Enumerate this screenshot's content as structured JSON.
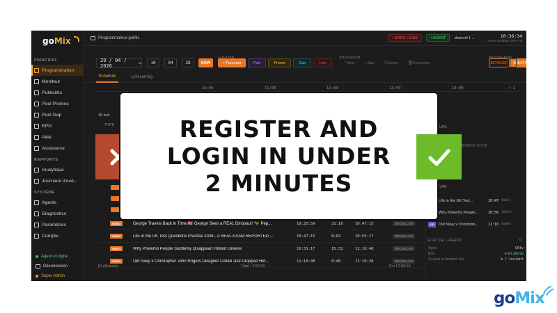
{
  "app": {
    "logo": {
      "go": "go",
      "mix": "Mix"
    },
    "window_title": "Programmateur goMix",
    "status_live": "• HORS LIGNE",
    "status_agent": "• AGENT",
    "channel": "channel 1",
    "clock": "10:36:34",
    "clock_sub": "Heure système (GMT+2)"
  },
  "sidebar": {
    "sections": [
      {
        "title": "PRINCIPAL",
        "items": [
          "Programmation",
          "Moniteur",
          "Publicités",
          "Pool Promos",
          "Pool Gap",
          "EPG",
          "Aide",
          "Assistance"
        ]
      },
      {
        "title": "RAPPORTS",
        "items": [
          "Analytique",
          "Journaux d'exé..."
        ]
      },
      {
        "title": "SYSTÈME",
        "items": [
          "Agents",
          "Diagnostics",
          "Paramètres",
          "Compte"
        ]
      }
    ],
    "footer": {
      "online": "Agent en ligne",
      "logout": "Déconnexion",
      "role": "Super Admin"
    }
  },
  "toolbar": {
    "date": "29 / 04 / 2026",
    "hh": "10",
    "mm": "04",
    "ss": "28",
    "now": "NOW",
    "group_add": "AJOUTER",
    "group_order": "ORGANISER",
    "group_prog": "PROGRAMME",
    "parcours": "+ Parcours",
    "pub": "Pub",
    "promo": "Promo",
    "gap": "Gap",
    "live": "Live",
    "haut": "Haut",
    "bas": "Bas",
    "copier": "Copier",
    "supprimer": "Supprimer",
    "effacer": "EFFACER",
    "envoyer": "ENVOYER",
    "more": "···"
  },
  "tabs": {
    "schedule": "Schedule",
    "recurring": "Recurring"
  },
  "timeline": [
    "10:00",
    "11:00",
    "12:00",
    "13:00",
    "14:00"
  ],
  "timeline_extra": "< 1",
  "partial": {
    "events": "16 évé",
    "type": "TYPE",
    "rs": "URS",
    "evt": "ÉVÉNEMENT ACTIF",
    "vre": "VRE"
  },
  "rows": [
    {
      "type": "VIDEO",
      "title": "George Travels Back in Time 🇬🇧 George Sees a REAL Dinosaur! 🦖 Pep...",
      "start": "10:25:59",
      "dur": "21:16",
      "end": "10:47:15",
      "status": "BROUILLON"
    },
    {
      "type": "VIDEO",
      "title": "Life in the UK Test Questions Practice 2026 - A REAL EXAM REPORTED ...",
      "start": "10:47:15",
      "dur": "8:02",
      "end": "10:55:17",
      "status": "BROUILLON"
    },
    {
      "type": "VIDEO",
      "title": "Why Powerful People Suddenly Disappear! Robert Greene",
      "start": "10:55:17",
      "dur": "15:31",
      "end": "11:10:48",
      "status": "BROUILLON"
    },
    {
      "type": "VIDEO",
      "title": "Old Navy x Christopher John Rogers Designer Collab Just Dropped Her...",
      "start": "11:10:48",
      "dur": "8:40",
      "end": "11:19:28",
      "status": "BROUILLON"
    }
  ],
  "table_footer": {
    "count": "16 éléments",
    "total": "Total : 2:53:00",
    "end": "Fin 12:59:10"
  },
  "right_panel": {
    "items": [
      {
        "badge": "",
        "title": "Life in the UK Test...",
        "time": "10:47",
        "dur": "8m02s"
      },
      {
        "badge": "",
        "title": "Why Powerful People...",
        "time": "10:56",
        "dur": "15m31s"
      },
      {
        "badge": "VID",
        "title": "Old Navy x Christoph...",
        "time": "11:10",
        "dur": "8m40s"
      }
    ],
    "agent_title": "ÉTAT DE L'AGENT",
    "agent_kv": [
      {
        "k": "Agent",
        "v": "G6tv"
      },
      {
        "k": "État",
        "v": "● En attente"
      },
      {
        "k": "Vu pour la dernière fois",
        "v": "à l'instant"
      }
    ]
  },
  "overlay": {
    "lines": [
      "REGISTER AND",
      "LOGIN IN UNDER",
      "2 MINUTES"
    ]
  },
  "brand": {
    "go": "go",
    "mix": "Mix"
  },
  "colors": {
    "accent": "#e8772a",
    "overlay_red": "#b54a31",
    "overlay_green": "#6dbb2b",
    "brand_dark": "#1c3e93",
    "brand_light": "#3fb4e8"
  }
}
